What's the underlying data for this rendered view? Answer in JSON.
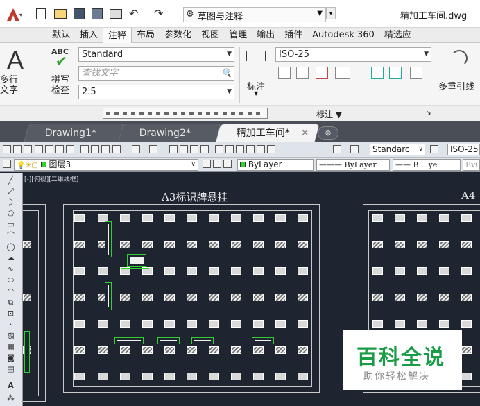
{
  "titlebar": {
    "workspace": "草图与注释",
    "file": "精加工车间.dwg"
  },
  "ribbon_tabs": [
    "默认",
    "插入",
    "注释",
    "布局",
    "参数化",
    "视图",
    "管理",
    "输出",
    "插件",
    "Autodesk 360",
    "精选应"
  ],
  "ribbon": {
    "multiline_text": "多行\n文字",
    "spell_check": "拼写\n检查",
    "text_style": "Standard",
    "find_text_placeholder": "查找文字",
    "text_height": "2.5",
    "dim_style": "ISO-25",
    "dimension_label": "标注",
    "multileader_label": "多重引线",
    "panel_title": "标注 ▼",
    "abc": "ABC"
  },
  "doc_tabs": [
    "Drawing1*",
    "Drawing2*",
    "精加工车间*"
  ],
  "toolbar": {
    "text_style": "Standarc",
    "dim_style": "ISO-25"
  },
  "layers": {
    "layer_name": "图层3",
    "color": "ByLayer",
    "linetype": "ByLayer",
    "lineweight": "B... ye",
    "plot": "BvC"
  },
  "canvas": {
    "view_label": "[-][俯视][二维线框]",
    "title_a3": "A3标识牌悬挂",
    "title_a4": "A4"
  },
  "watermark": {
    "title": "百科全说",
    "subtitle": "助你轻松解决"
  },
  "colors": {
    "accent_green": "#2fd02f",
    "canvas_bg": "#1e2430",
    "logo_red": "#c0392b",
    "watermark_green": "#1a9c46"
  }
}
